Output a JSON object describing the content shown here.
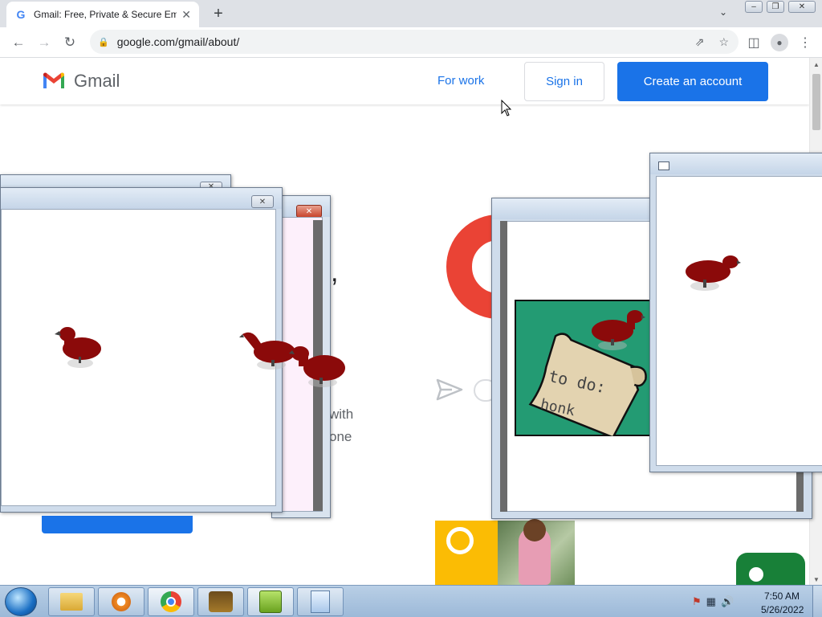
{
  "browser": {
    "tab_title": "Gmail: Free, Private & Secure Em",
    "tab_close": "✕",
    "new_tab": "+",
    "tab_menu": "⌄",
    "url": "google.com/gmail/about/",
    "window_buttons": {
      "minimize": "–",
      "restore": "❐",
      "close": "✕"
    }
  },
  "gmail": {
    "logo_text": "Gmail",
    "nav": {
      "for_work": "For work",
      "sign_in": "Sign in",
      "create_account": "Create an account"
    },
    "hero_comma": ",",
    "hero_line1": "with",
    "hero_line2": "one"
  },
  "popup_notepad": {
    "line1": "to do:",
    "line2": "honk"
  },
  "popup_icons": {
    "close": "✕"
  },
  "taskbar": {
    "tray_icons": [
      "flag-icon",
      "network-icon",
      "volume-icon"
    ],
    "time": "7:50 AM",
    "date": "5/26/2022"
  },
  "colors": {
    "gmail_blue": "#1a73e8",
    "gmail_red": "#ea4335",
    "gmail_yellow": "#fbbc04",
    "gmail_green": "#188038",
    "goose": "#8b0a0a",
    "note_bg": "#239b73",
    "scroll_paper": "#e3d3b0"
  }
}
